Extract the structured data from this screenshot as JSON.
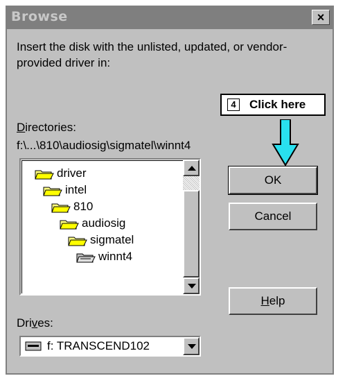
{
  "dialog": {
    "title": "Browse",
    "close_label": "×",
    "instruction": "Insert the disk with the unlisted, updated, or vendor-provided driver in:"
  },
  "callout": {
    "step": "4",
    "text": "Click here"
  },
  "directories": {
    "label_mnemonic": "D",
    "label_rest": "irectories:",
    "path": "f:\\...\\810\\audiosig\\sigmatel\\winnt4",
    "items": [
      "driver",
      "intel",
      "810",
      "audiosig",
      "sigmatel",
      "winnt4"
    ],
    "selected": "winnt4"
  },
  "buttons": {
    "ok": "OK",
    "cancel": "Cancel",
    "help_mnemonic": "H",
    "help_rest": "elp"
  },
  "drives": {
    "label_pre": "Dri",
    "label_mnemonic": "v",
    "label_post": "es:",
    "value": "f: TRANSCEND102"
  },
  "colors": {
    "arrow": "#29e0ef",
    "titlebar": "#7f7f7f",
    "face": "#c0c0c0"
  },
  "icons": [
    "close-icon",
    "folder-open-icon",
    "folder-selected-icon",
    "arrow-down-icon",
    "drive-icon"
  ]
}
